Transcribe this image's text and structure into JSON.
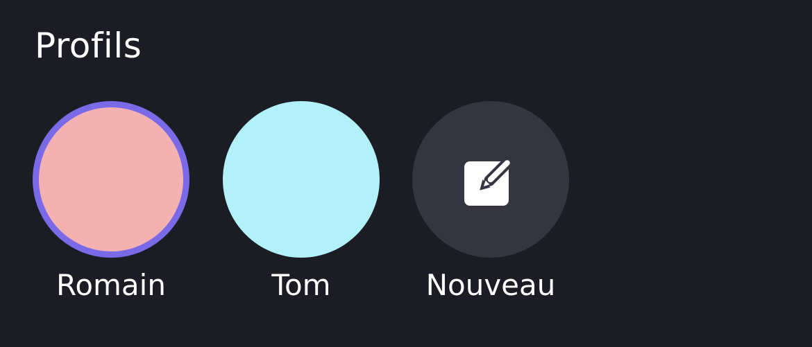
{
  "title": "Profils",
  "profiles": [
    {
      "name": "Romain",
      "color": "#f4b1b1",
      "selected": true,
      "selection_color": "#7b6ae8"
    },
    {
      "name": "Tom",
      "color": "#b2f1fa",
      "selected": false
    },
    {
      "name": "Nouveau",
      "color": "#353542",
      "icon": "edit-icon"
    }
  ],
  "colors": {
    "background": "#1c1c25",
    "text": "#ffffff"
  }
}
